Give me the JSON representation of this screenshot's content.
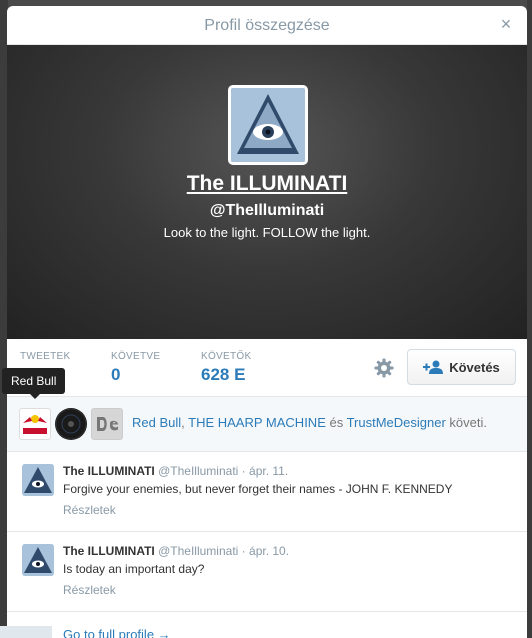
{
  "modal": {
    "title": "Profil összegzése",
    "close_label": "×"
  },
  "profile": {
    "name": "The ILLUMINATI",
    "handle": "@TheIlluminati",
    "bio": "Look to the light. FOLLOW the light."
  },
  "stats": [
    {
      "label": "TWEETEK",
      "value": ""
    },
    {
      "label": "KÖVETVE",
      "value": "0"
    },
    {
      "label": "KÖVETŐK",
      "value": "628 E"
    }
  ],
  "follow_button": {
    "label": "Követés"
  },
  "followed_by": {
    "names": [
      "Red Bull",
      "THE HAARP MACHINE",
      "TrustMeDesigner"
    ],
    "separator": ", ",
    "conjunction": " és ",
    "suffix": " követi."
  },
  "tooltip": {
    "text": "Red Bull"
  },
  "tweets": [
    {
      "name": "The ILLUMINATI",
      "handle": "@TheIlluminati",
      "date": "ápr. 11.",
      "text": "Forgive your enemies, but never forget their names - JOHN F. KENNEDY",
      "details": "Részletek"
    },
    {
      "name": "The ILLUMINATI",
      "handle": "@TheIlluminati",
      "date": "ápr. 10.",
      "text": "Is today an important day?",
      "details": "Részletek"
    }
  ],
  "footer": {
    "full_profile_link": "Go to full profile →"
  },
  "colors": {
    "link": "#2b7bb9",
    "muted": "#8899a6"
  }
}
